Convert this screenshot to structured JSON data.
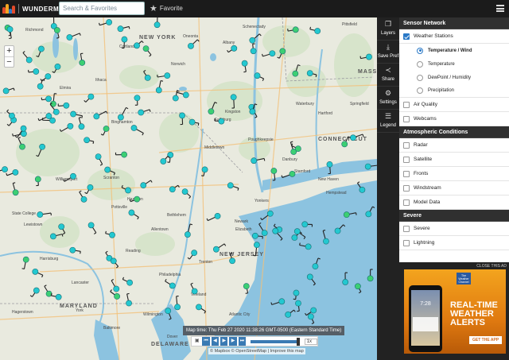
{
  "header": {
    "logo_text": "WUNDERMAP",
    "search_placeholder": "Search & Favorites",
    "favorite_label": "Favorite"
  },
  "toolbar": [
    {
      "label": "Layers",
      "icon": "layers-icon",
      "glyph": "❐"
    },
    {
      "label": "Save Pref",
      "icon": "download-icon",
      "glyph": "⤓"
    },
    {
      "label": "Share",
      "icon": "share-icon",
      "glyph": "≺"
    },
    {
      "label": "Settings",
      "icon": "gear-icon",
      "glyph": "⚙"
    },
    {
      "label": "Legend",
      "icon": "list-icon",
      "glyph": "☰"
    }
  ],
  "panel": {
    "sensor_network": {
      "title": "Sensor Network",
      "weather_stations": {
        "label": "Weather Stations",
        "checked": true
      },
      "options": [
        {
          "label": "Temperature / Wind",
          "selected": true
        },
        {
          "label": "Temperature",
          "selected": false
        },
        {
          "label": "DewPoint / Humidity",
          "selected": false
        },
        {
          "label": "Precipitation",
          "selected": false
        }
      ],
      "air_quality": "Air Quality",
      "webcams": "Webcams"
    },
    "atmospheric": {
      "title": "Atmospheric Conditions",
      "items": [
        "Radar",
        "Satellite",
        "Fronts",
        "Windstream",
        "Model Data"
      ]
    },
    "severe": {
      "title": "Severe",
      "items": [
        "Severe",
        "Lightning"
      ]
    }
  },
  "map": {
    "zoom_in": "+",
    "zoom_out": "−",
    "map_time": "Map time: Thu Feb 27 2020 11:38:26 GMT-0500 (Eastern Standard Time)",
    "speed": "1x",
    "attribution": "© Mapbox © OpenStreetMap | Improve this map",
    "labels": [
      "NEW YORK",
      "CONNECTICUT",
      "NEW JERSEY",
      "MARYLAND",
      "DELAWARE",
      "MASSA",
      "Richmond",
      "Elmira",
      "Ithaca",
      "Cortland",
      "Binghamton",
      "Albany",
      "Schenectady",
      "Hartford",
      "Poughkeepsie",
      "Kingston",
      "Middletown",
      "Danbury",
      "New Haven",
      "Scranton",
      "Williamsport",
      "State College",
      "Allentown",
      "Newark",
      "Yonkers",
      "Elizabeth",
      "Trenton",
      "Harrisburg",
      "Lancaster",
      "Philadelphia",
      "Wilmington",
      "York",
      "Hagerstown",
      "Baltimore",
      "Dover",
      "Atlantic City",
      "Vineland",
      "Lewistown",
      "Pottsville",
      "Reading",
      "Bethlehem",
      "Stamford",
      "Waterbury",
      "Pittsfield",
      "Springfield",
      "Hempstead",
      "Fallsburg",
      "Hazleton",
      "Oneonta",
      "Norwich"
    ]
  },
  "ad": {
    "close_label": "CLOSE THIS AD",
    "brand": "The Weather Channel",
    "headline": "REAL-TIME WEATHER ALERTS",
    "cta": "GET THE APP",
    "phone_time": "7:28"
  },
  "colors": {
    "top_bar": "#1b1b1b",
    "water": "#8cc3e0",
    "land": "#e9eadf",
    "forest": "#cfe1c2",
    "station_cyan": "#23c8d0",
    "station_green": "#3ccf73",
    "accent": "#2a79c7"
  }
}
